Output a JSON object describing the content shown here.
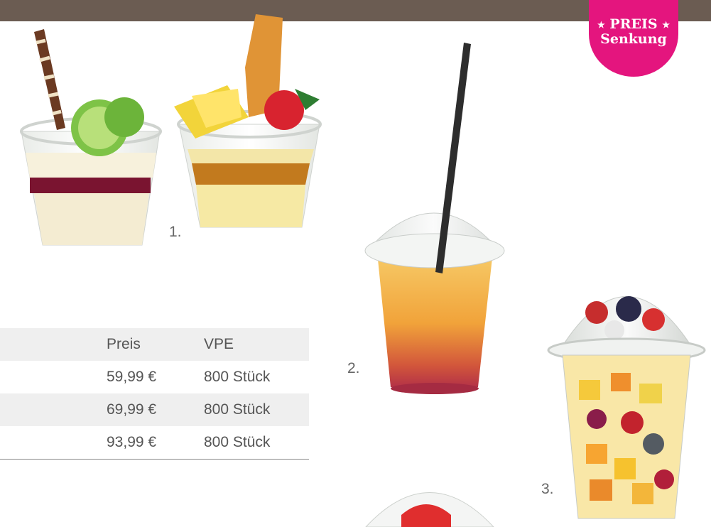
{
  "header": {
    "bar_color": "#6b5c52"
  },
  "badge": {
    "line1": "PREIS",
    "line2": "Senkung",
    "star": "★",
    "color": "#e4157e"
  },
  "photos": [
    {
      "label": "1.",
      "content": "dessert-cups"
    },
    {
      "label": "2.",
      "content": "smoothie-cup"
    },
    {
      "label": "3.",
      "content": "fruit-salad-cup"
    }
  ],
  "table": {
    "headers": [
      "",
      "Preis",
      "VPE"
    ],
    "rows": [
      {
        "name": "",
        "price": "59,99 €",
        "vpe": "800 Stück"
      },
      {
        "name": "",
        "price": "69,99 €",
        "vpe": "800 Stück"
      },
      {
        "name": "",
        "price": "93,99 €",
        "vpe": "800 Stück"
      }
    ]
  }
}
